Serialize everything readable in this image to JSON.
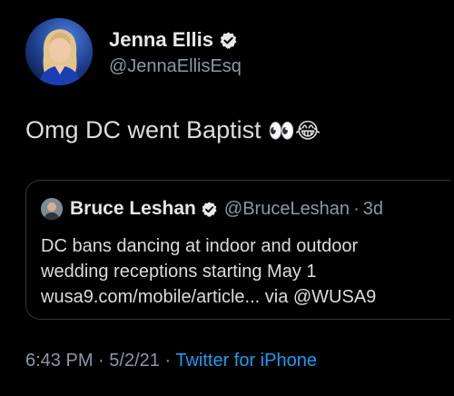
{
  "author": {
    "display_name": "Jenna Ellis",
    "handle": "@JennaEllisEsq",
    "verified": true,
    "avatar_icon": "profile-photo-avatar"
  },
  "tweet": {
    "text": "Omg DC went Baptist",
    "emojis": "👀😂"
  },
  "quoted_tweet": {
    "author_name": "Bruce Leshan",
    "author_handle": "@BruceLeshan",
    "separator": "·",
    "time_ago": "3d",
    "verified": true,
    "lines": [
      "DC bans dancing at indoor and outdoor",
      "wedding receptions starting May 1",
      "wusa9.com/mobile/article... via @WUSA9"
    ]
  },
  "meta": {
    "time": "6:43 PM",
    "separator": "·",
    "date": "5/2/21",
    "source": "Twitter for iPhone"
  },
  "colors": {
    "background": "#000000",
    "link": "#1d9bf0",
    "secondary_text": "#8b98a5",
    "border": "#333639"
  }
}
